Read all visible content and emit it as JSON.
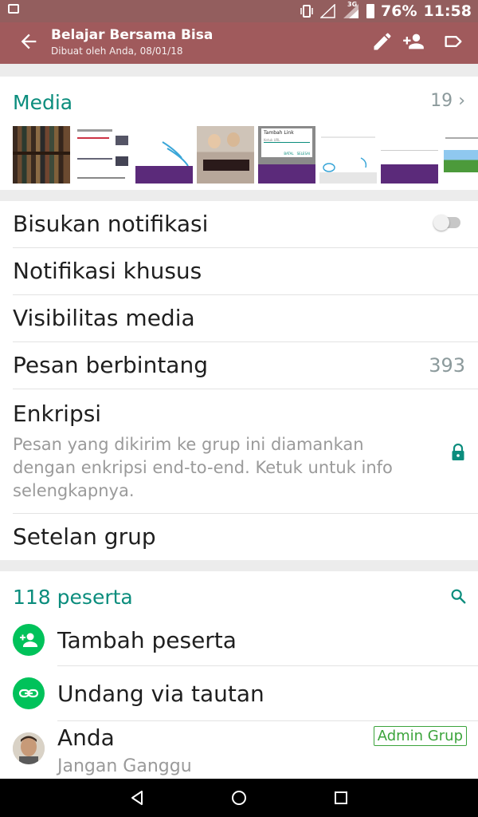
{
  "status_bar": {
    "battery": "76%",
    "time": "11:58",
    "network": "3G"
  },
  "header": {
    "title": "Belajar Bersama Bisa",
    "subtitle": "Dibuat oleh Anda, 08/01/18",
    "icons": [
      "back-arrow-icon",
      "edit-icon",
      "add-person-icon",
      "label-icon"
    ]
  },
  "media": {
    "title": "Media",
    "count": "19",
    "chevron": "›",
    "thumb_texts": {
      "dialog_title": "Tambah Link",
      "dialog_hint": "Ketuk URL",
      "dialog_cancel": "BATAL",
      "dialog_ok": "SELESAI"
    }
  },
  "settings": {
    "mute": {
      "label": "Bisukan notifikasi",
      "on": false
    },
    "custom_notif": {
      "label": "Notifikasi khusus"
    },
    "media_visibility": {
      "label": "Visibilitas media"
    },
    "starred": {
      "label": "Pesan berbintang",
      "count": "393"
    },
    "encryption": {
      "label": "Enkripsi",
      "description": "Pesan yang dikirim ke grup ini diamankan dengan enkripsi end-to-end. Ketuk untuk info selengkapnya."
    },
    "group_settings": {
      "label": "Setelan grup"
    }
  },
  "participants": {
    "title": "118 peserta",
    "add_label": "Tambah peserta",
    "invite_label": "Undang via tautan",
    "members": [
      {
        "name": "Anda",
        "status": "Jangan Ganggu",
        "badge": "Admin Grup"
      }
    ]
  },
  "colors": {
    "accent": "#0b8d7d",
    "toolbar": "#a05a5c",
    "status_bar": "#935e5e",
    "green": "#00c25a",
    "admin_badge": "#3ca43c"
  }
}
